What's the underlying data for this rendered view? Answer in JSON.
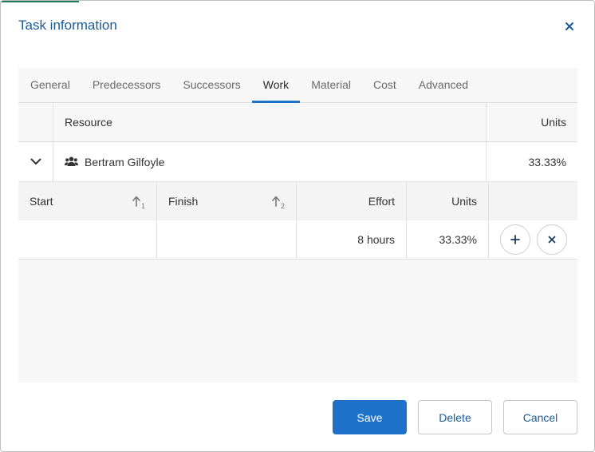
{
  "dialog": {
    "title": "Task information"
  },
  "tabs": [
    {
      "label": "General"
    },
    {
      "label": "Predecessors"
    },
    {
      "label": "Successors"
    },
    {
      "label": "Work"
    },
    {
      "label": "Material"
    },
    {
      "label": "Cost"
    },
    {
      "label": "Advanced"
    }
  ],
  "grid": {
    "headers": {
      "resource": "Resource",
      "units": "Units"
    },
    "resource_row": {
      "name": "Bertram Gilfoyle",
      "units": "33.33%"
    },
    "sub_headers": {
      "start": "Start",
      "start_sort": "1",
      "finish": "Finish",
      "finish_sort": "2",
      "effort": "Effort",
      "units": "Units"
    },
    "sub_row": {
      "start": "",
      "finish": "",
      "effort": "8 hours",
      "units": "33.33%"
    }
  },
  "buttons": {
    "save": "Save",
    "delete": "Delete",
    "cancel": "Cancel"
  },
  "colors": {
    "accent": "#1f72c9",
    "title": "#1a5b96",
    "top_accent": "#1f7a5c"
  },
  "icons": {
    "close": "close-icon",
    "expand": "chevron-down-icon",
    "resource": "users-icon",
    "sort": "arrow-up-icon",
    "add": "plus-icon",
    "remove": "x-icon"
  }
}
